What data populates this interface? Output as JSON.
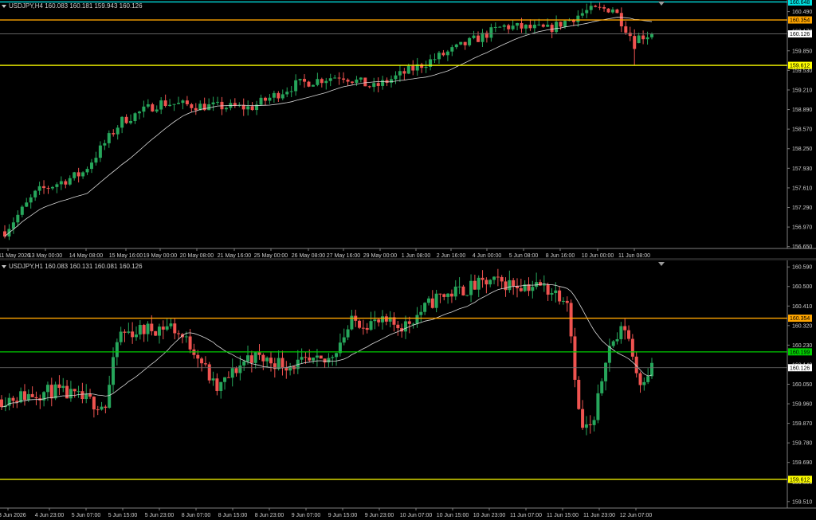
{
  "charts": [
    {
      "id": "h4",
      "title": "USDJPY,H4  160.083 160.181 159.943 160.126",
      "price_scale": [
        "160.490",
        "160.170",
        "159.850",
        "159.530",
        "159.210",
        "158.890",
        "158.570",
        "158.250",
        "157.930",
        "157.610",
        "157.290",
        "156.970",
        "156.650"
      ],
      "time_scale": [
        "11 May 2026",
        "13 May 00:00",
        "14 May 08:00",
        "15 May 16:00",
        "19 May 00:00",
        "20 May 08:00",
        "21 May 16:00",
        "25 May 00:00",
        "26 May 08:00",
        "27 May 16:00",
        "29 May 00:00",
        "1 Jun 08:00",
        "2 Jun 16:00",
        "4 Jun 00:00",
        "5 Jun 08:00",
        "8 Jun 16:00",
        "10 Jun 00:00",
        "11 Jun 08:00"
      ],
      "levels": [
        {
          "value": "160.648",
          "color": "#00e0e0"
        },
        {
          "value": "160.354",
          "color": "#ffa500"
        },
        {
          "value": "159.612",
          "color": "#ffff00"
        }
      ],
      "current_price": "160.126"
    },
    {
      "id": "h1",
      "title": "USDJPY,H1  160.083 160.131 160.081 160.126",
      "price_scale": [
        "160.590",
        "160.500",
        "160.410",
        "160.320",
        "160.230",
        "160.140",
        "160.050",
        "159.960",
        "159.870",
        "159.780",
        "159.690",
        "159.600",
        "159.510"
      ],
      "time_scale": [
        "3 Jun 2026",
        "4 Jun 23:00",
        "5 Jun 07:00",
        "5 Jun 15:00",
        "5 Jun 23:00",
        "8 Jun 07:00",
        "8 Jun 15:00",
        "8 Jun 23:00",
        "9 Jun 07:00",
        "9 Jun 15:00",
        "9 Jun 23:00",
        "10 Jun 07:00",
        "10 Jun 15:00",
        "10 Jun 23:00",
        "11 Jun 07:00",
        "11 Jun 15:00",
        "11 Jun 23:00",
        "12 Jun 07:00"
      ],
      "levels": [
        {
          "value": "160.354",
          "color": "#ffa500"
        },
        {
          "value": "160.199",
          "color": "#00cc00"
        },
        {
          "value": "159.612",
          "color": "#ffff00"
        }
      ],
      "current_price": "160.126"
    }
  ],
  "colors": {
    "bull": "#26a65b",
    "bear": "#ef5350",
    "ma": "#d8d8d8",
    "axis": "#808080",
    "price_line": "#707070"
  }
}
